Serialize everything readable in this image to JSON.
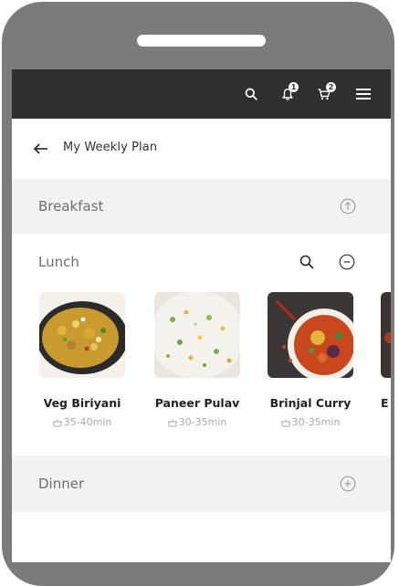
{
  "topbar": {
    "icons": [
      "search-icon",
      "bell-icon",
      "cart-icon",
      "menu-icon"
    ],
    "notifications_count": "1",
    "cart_count": "2"
  },
  "header": {
    "title": "My Weekly Plan"
  },
  "breakfast": {
    "label": "Breakfast"
  },
  "lunch": {
    "label": "Lunch",
    "items": [
      {
        "name": "Veg Biriyani",
        "time": "35-40min"
      },
      {
        "name": "Paneer Pulav",
        "time": "30-35min"
      },
      {
        "name": "Brinjal Curry",
        "time": "30-35min"
      },
      {
        "name": "E",
        "time": ""
      }
    ]
  },
  "dinner": {
    "label": "Dinner"
  },
  "colors": {
    "topbar": "#2f2f2f",
    "frame": "#7b7b7b",
    "section_bg": "#f2f2f2",
    "text": "#222222",
    "muted": "#a8a8a8"
  }
}
